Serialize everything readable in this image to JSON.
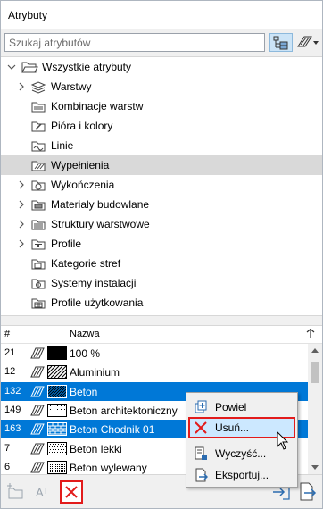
{
  "window": {
    "title": "Atrybuty"
  },
  "search": {
    "placeholder": "Szukaj atrybutów"
  },
  "tree": {
    "root": "Wszystkie atrybuty",
    "items": [
      {
        "label": "Warstwy",
        "expandable": true,
        "icon": "layers-icon"
      },
      {
        "label": "Kombinacje warstw",
        "expandable": false,
        "icon": "layer-combinations-icon"
      },
      {
        "label": "Pióra i kolory",
        "expandable": false,
        "icon": "pens-icon"
      },
      {
        "label": "Linie",
        "expandable": false,
        "icon": "line-types-icon"
      },
      {
        "label": "Wypełnienia",
        "expandable": false,
        "icon": "fills-icon",
        "selected": true
      },
      {
        "label": "Wykończenia",
        "expandable": true,
        "icon": "surfaces-icon"
      },
      {
        "label": "Materiały budowlane",
        "expandable": true,
        "icon": "building-materials-icon"
      },
      {
        "label": "Struktury warstwowe",
        "expandable": true,
        "icon": "composites-icon"
      },
      {
        "label": "Profile",
        "expandable": true,
        "icon": "profiles-icon"
      },
      {
        "label": "Kategorie stref",
        "expandable": false,
        "icon": "zone-categories-icon"
      },
      {
        "label": "Systemy instalacji",
        "expandable": false,
        "icon": "mep-systems-icon"
      },
      {
        "label": "Profile użytkowania",
        "expandable": false,
        "icon": "operation-profiles-icon"
      }
    ]
  },
  "table": {
    "headers": {
      "num": "#",
      "name": "Nazwa"
    },
    "rows": [
      {
        "num": "21",
        "name": "100 %",
        "selected": false,
        "pattern": "solid"
      },
      {
        "num": "12",
        "name": "Aluminium",
        "selected": false,
        "pattern": "diagonal"
      },
      {
        "num": "132",
        "name": "Beton",
        "selected": true,
        "pattern": "diagonal-dense"
      },
      {
        "num": "149",
        "name": "Beton architektoniczny",
        "selected": false,
        "pattern": "dots-sparse"
      },
      {
        "num": "163",
        "name": "Beton Chodnik 01",
        "selected": true,
        "pattern": "brick"
      },
      {
        "num": "7",
        "name": "Beton lekki",
        "selected": false,
        "pattern": "dots"
      },
      {
        "num": "6",
        "name": "Beton wylewany",
        "selected": false,
        "pattern": "dots-dense"
      }
    ]
  },
  "context_menu": {
    "items": [
      {
        "label": "Powiel",
        "icon": "duplicate-icon",
        "highlighted": false
      },
      {
        "label": "Usuń...",
        "icon": "delete-icon",
        "highlighted": true
      },
      {
        "label": "Wyczyść...",
        "icon": "purge-icon",
        "highlighted": false
      },
      {
        "label": "Eksportuj...",
        "icon": "export-icon",
        "highlighted": false
      }
    ]
  },
  "colors": {
    "selection": "#0078d7",
    "highlight_border": "#e21b1b",
    "menu_hover": "#cce8ff"
  }
}
